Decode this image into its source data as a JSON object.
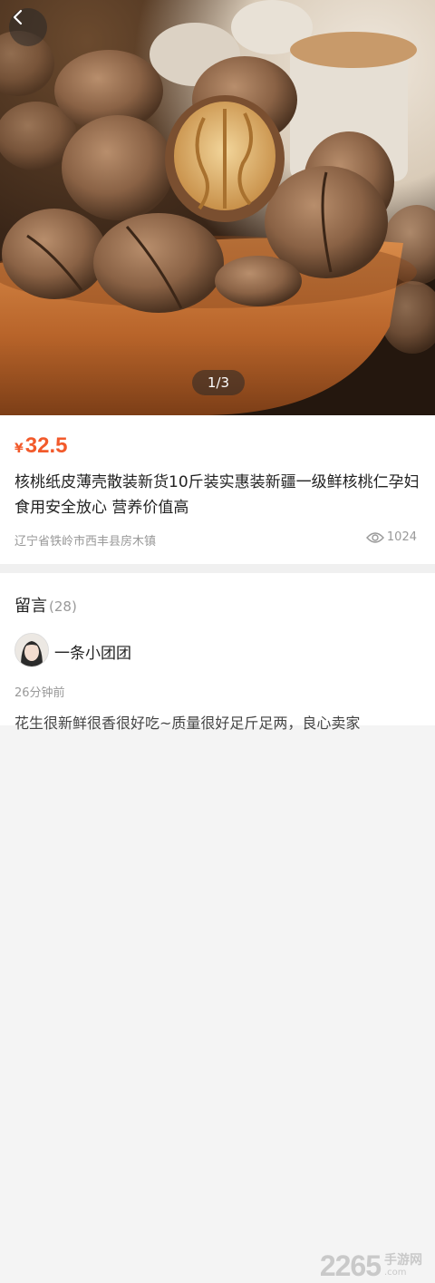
{
  "hero": {
    "pager": "1/3"
  },
  "product": {
    "currency": "¥",
    "price": "32.5",
    "title": "核桃纸皮薄壳散装新货10斤装实惠装新疆一级鲜核桃仁孕妇食用安全放心 营养价值高",
    "location": "辽宁省铁岭市西丰县房木镇",
    "views": "1024"
  },
  "comments": {
    "label": "留言",
    "count": "(28)",
    "items": [
      {
        "user": "一条小团团",
        "time": "26分钟前",
        "text": "花生很新鲜很香很好吃~质量很好足斤足两，良心卖家"
      }
    ]
  },
  "watermark": {
    "number": "2265",
    "suffix": ".com",
    "cn": "手游网"
  },
  "colors": {
    "accent": "#f25a2b",
    "muted": "#999999"
  },
  "icons": [
    "back-arrow-icon",
    "eye-icon"
  ]
}
